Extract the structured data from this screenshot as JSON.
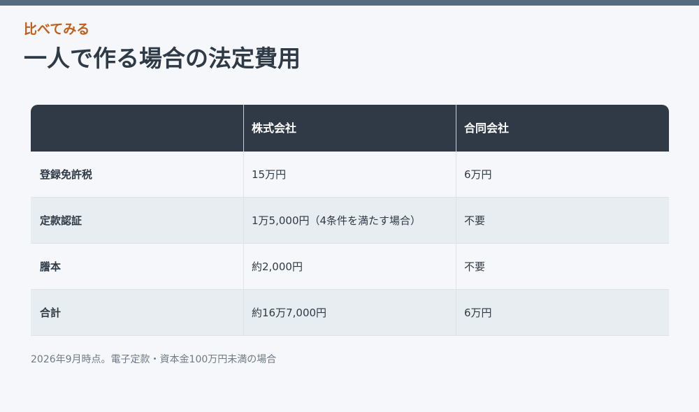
{
  "header": {
    "eyebrow": "比べてみる",
    "title": "一人で作る場合の法定費用"
  },
  "table": {
    "columns": [
      "",
      "株式会社",
      "合同会社"
    ],
    "rows": [
      [
        "登録免許税",
        "15万円",
        "6万円"
      ],
      [
        "定款認証",
        "1万5,000円（4条件を満たす場合）",
        "不要"
      ],
      [
        "謄本",
        "約2,000円",
        "不要"
      ],
      [
        "合計",
        "約16万7,000円",
        "6万円"
      ]
    ]
  },
  "footnote": "2026年9月時点。電子定款・資本金100万円未満の場合",
  "colors": {
    "accent": "#c0601e",
    "header_bg": "#2f3a46",
    "top_bar": "#566a80",
    "row_alt": "#e8edf1"
  }
}
